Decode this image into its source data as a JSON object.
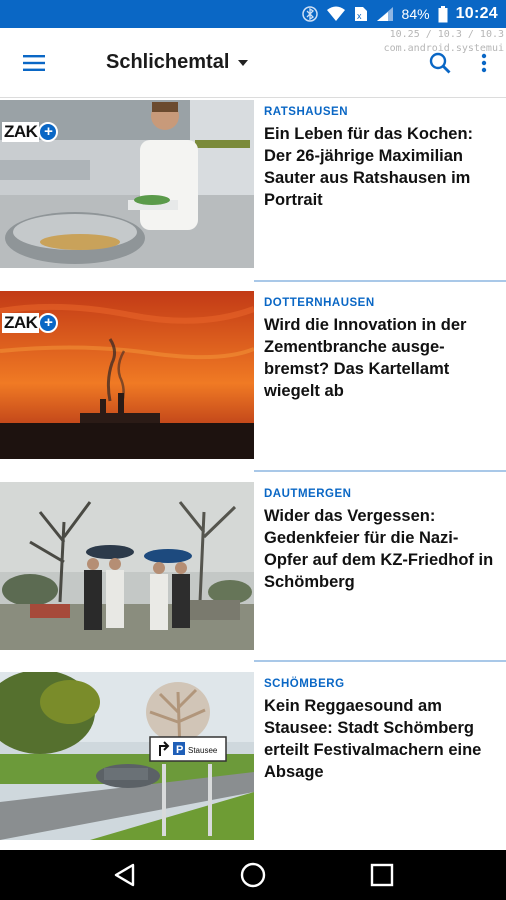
{
  "status_bar": {
    "battery": "84%",
    "time": "10:24",
    "icons": [
      "bluetooth-icon",
      "wifi-icon",
      "sim-icon",
      "signal-icon",
      "battery-icon"
    ]
  },
  "app_bar": {
    "title": "Schlichemtal",
    "menu_icon": "hamburger-menu-icon",
    "dropdown_icon": "dropdown-arrow-icon",
    "search_icon": "search-icon",
    "overflow_icon": "overflow-menu-icon"
  },
  "debug_overlay": {
    "line1": "10.25 / 10.3 / 10.3",
    "line2": "com.android.systemui"
  },
  "articles": [
    {
      "category": "RATSHAUSEN",
      "headline": "Ein Leben für das Kochen: Der 26-jährige Maximilian Sauter aus Ratshausen im Portrait",
      "badge": "ZAK"
    },
    {
      "category": "DOTTERNHAUSEN",
      "headline": "Wird die Innovation in der Zementbranche ausge-bremst? Das Kartellamt wiegelt ab",
      "badge": "ZAK"
    },
    {
      "category": "DAUTMERGEN",
      "headline": "Wider das Vergessen: Gedenkfeier für die Nazi-Opfer auf dem KZ-Friedhof in Schömberg"
    },
    {
      "category": "SCHÖMBERG",
      "headline": "Kein Reggaesound am Stausee: Stadt Schömberg erteilt Festivalmachern eine Absage",
      "sign_text": "Stausee"
    }
  ],
  "colors": {
    "accent": "#0a67c5",
    "divider": "#a9c8e8",
    "headline": "#111111"
  },
  "nav_bar": {
    "icons": [
      "back-icon",
      "home-icon",
      "recents-icon"
    ]
  }
}
